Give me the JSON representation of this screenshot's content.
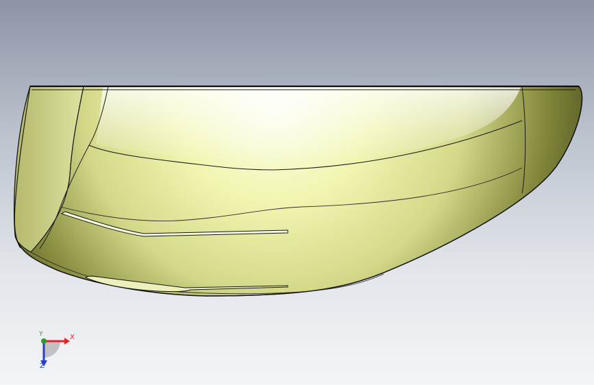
{
  "viewport": {
    "background_top": "#8b95a6",
    "background_bottom": "#f4f5f7"
  },
  "model": {
    "body_color": "#eef3a8",
    "shade_color": "#3d4218",
    "edge_color": "#151515"
  },
  "triad": {
    "x_label": "X",
    "y_label": "Y",
    "z_label": "Z",
    "x_color": "#e0242a",
    "y_color": "#2d9a2d",
    "z_color": "#2840c8"
  }
}
